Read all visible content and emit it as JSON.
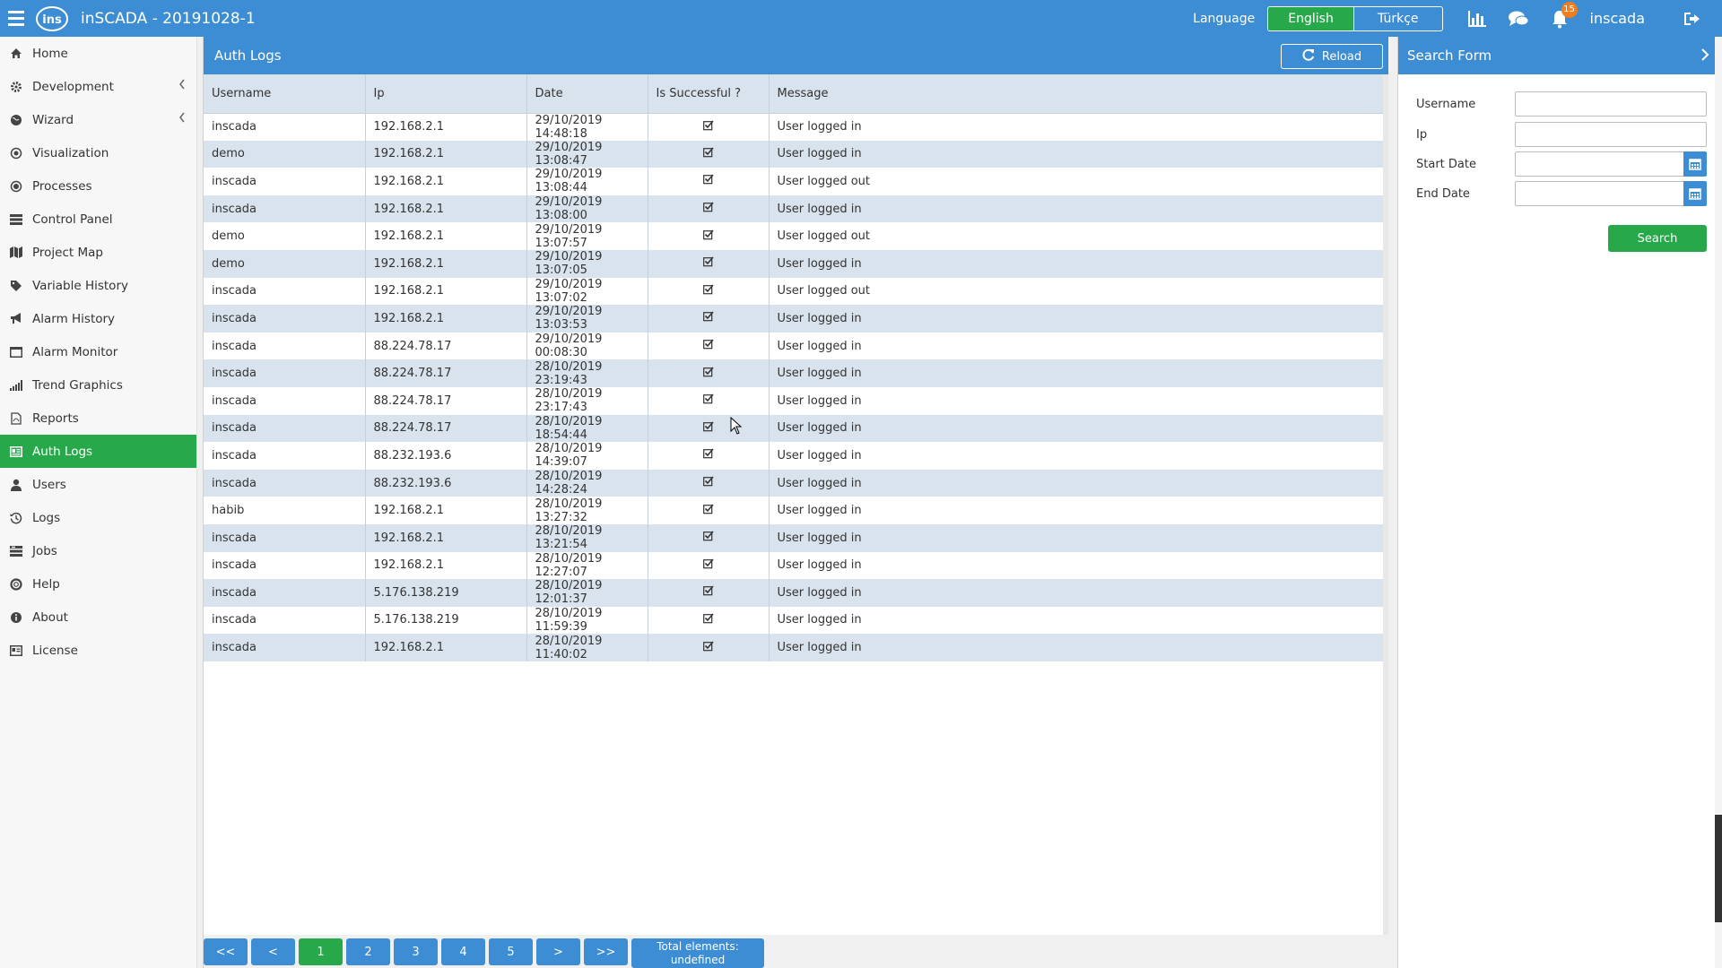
{
  "app": {
    "title": "inSCADA - 20191028-1"
  },
  "topbar": {
    "language_label": "Language",
    "languages": [
      "English",
      "Türkçe"
    ],
    "selected_language": "English",
    "notification_count": "15",
    "username": "inscada"
  },
  "sidebar": {
    "items": [
      {
        "label": "Home",
        "icon": "home-icon"
      },
      {
        "label": "Development",
        "icon": "cog-icon",
        "has_chevron": true
      },
      {
        "label": "Wizard",
        "icon": "globe-icon",
        "has_chevron": true
      },
      {
        "label": "Visualization",
        "icon": "eye-icon"
      },
      {
        "label": "Processes",
        "icon": "circle-dot-icon"
      },
      {
        "label": "Control Panel",
        "icon": "list-icon"
      },
      {
        "label": "Project Map",
        "icon": "map-icon"
      },
      {
        "label": "Variable History",
        "icon": "tags-icon"
      },
      {
        "label": "Alarm History",
        "icon": "bullhorn-icon"
      },
      {
        "label": "Alarm Monitor",
        "icon": "window-icon"
      },
      {
        "label": "Trend Graphics",
        "icon": "signal-icon"
      },
      {
        "label": "Reports",
        "icon": "file-pdf-icon"
      },
      {
        "label": "Auth Logs",
        "icon": "id-card-icon",
        "active": true
      },
      {
        "label": "Users",
        "icon": "user-icon"
      },
      {
        "label": "Logs",
        "icon": "history-icon"
      },
      {
        "label": "Jobs",
        "icon": "tasks-icon"
      },
      {
        "label": "Help",
        "icon": "life-ring-icon"
      },
      {
        "label": "About",
        "icon": "info-icon"
      },
      {
        "label": "License",
        "icon": "license-card-icon"
      }
    ]
  },
  "main": {
    "title": "Auth Logs",
    "reload_label": "Reload",
    "columns": [
      "Username",
      "Ip",
      "Date",
      "Is Successful ?",
      "Message"
    ],
    "rows": [
      {
        "username": "inscada",
        "ip": "192.168.2.1",
        "date": "29/10/2019 14:48:18",
        "success": true,
        "message": "User logged in"
      },
      {
        "username": "demo",
        "ip": "192.168.2.1",
        "date": "29/10/2019 13:08:47",
        "success": true,
        "message": "User logged in"
      },
      {
        "username": "inscada",
        "ip": "192.168.2.1",
        "date": "29/10/2019 13:08:44",
        "success": true,
        "message": "User logged out"
      },
      {
        "username": "inscada",
        "ip": "192.168.2.1",
        "date": "29/10/2019 13:08:00",
        "success": true,
        "message": "User logged in"
      },
      {
        "username": "demo",
        "ip": "192.168.2.1",
        "date": "29/10/2019 13:07:57",
        "success": true,
        "message": "User logged out"
      },
      {
        "username": "demo",
        "ip": "192.168.2.1",
        "date": "29/10/2019 13:07:05",
        "success": true,
        "message": "User logged in"
      },
      {
        "username": "inscada",
        "ip": "192.168.2.1",
        "date": "29/10/2019 13:07:02",
        "success": true,
        "message": "User logged out"
      },
      {
        "username": "inscada",
        "ip": "192.168.2.1",
        "date": "29/10/2019 13:03:53",
        "success": true,
        "message": "User logged in"
      },
      {
        "username": "inscada",
        "ip": "88.224.78.17",
        "date": "29/10/2019 00:08:30",
        "success": true,
        "message": "User logged in"
      },
      {
        "username": "inscada",
        "ip": "88.224.78.17",
        "date": "28/10/2019 23:19:43",
        "success": true,
        "message": "User logged in"
      },
      {
        "username": "inscada",
        "ip": "88.224.78.17",
        "date": "28/10/2019 23:17:43",
        "success": true,
        "message": "User logged in"
      },
      {
        "username": "inscada",
        "ip": "88.224.78.17",
        "date": "28/10/2019 18:54:44",
        "success": true,
        "message": "User logged in"
      },
      {
        "username": "inscada",
        "ip": "88.232.193.6",
        "date": "28/10/2019 14:39:07",
        "success": true,
        "message": "User logged in"
      },
      {
        "username": "inscada",
        "ip": "88.232.193.6",
        "date": "28/10/2019 14:28:24",
        "success": true,
        "message": "User logged in"
      },
      {
        "username": "habib",
        "ip": "192.168.2.1",
        "date": "28/10/2019 13:27:32",
        "success": true,
        "message": "User logged in"
      },
      {
        "username": "inscada",
        "ip": "192.168.2.1",
        "date": "28/10/2019 13:21:54",
        "success": true,
        "message": "User logged in"
      },
      {
        "username": "inscada",
        "ip": "192.168.2.1",
        "date": "28/10/2019 12:27:07",
        "success": true,
        "message": "User logged in"
      },
      {
        "username": "inscada",
        "ip": "5.176.138.219",
        "date": "28/10/2019 12:01:37",
        "success": true,
        "message": "User logged in"
      },
      {
        "username": "inscada",
        "ip": "5.176.138.219",
        "date": "28/10/2019 11:59:39",
        "success": true,
        "message": "User logged in"
      },
      {
        "username": "inscada",
        "ip": "192.168.2.1",
        "date": "28/10/2019 11:40:02",
        "success": true,
        "message": "User logged in"
      }
    ],
    "pagination": {
      "first": "<<",
      "prev": "<",
      "pages": [
        "1",
        "2",
        "3",
        "4",
        "5"
      ],
      "current": "1",
      "next": ">",
      "last": ">>",
      "total_label": "Total elements: undefined"
    }
  },
  "search_form": {
    "title": "Search Form",
    "fields": {
      "username_label": "Username",
      "username_value": "",
      "ip_label": "Ip",
      "ip_value": "",
      "start_date_label": "Start Date",
      "start_date_value": "",
      "end_date_label": "End Date",
      "end_date_value": ""
    },
    "search_button": "Search"
  },
  "colors": {
    "primary_blue": "#3c8dd3",
    "active_green": "#27a84a",
    "row_alt": "#d9e3ee",
    "badge_orange": "#f07d1e"
  }
}
